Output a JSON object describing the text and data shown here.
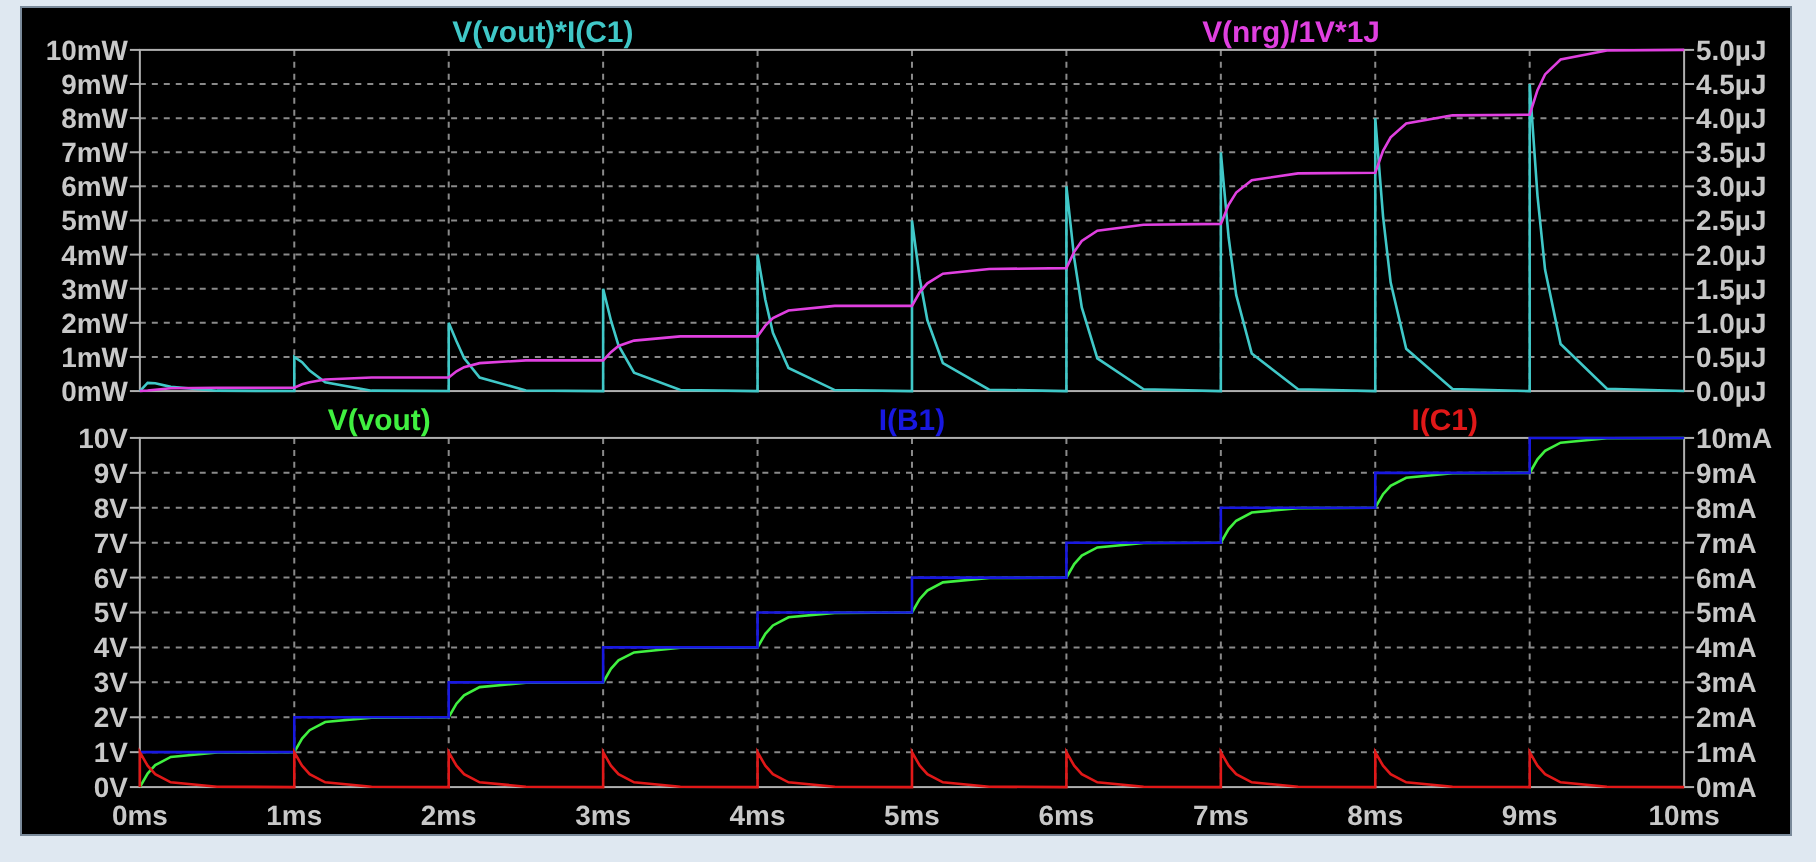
{
  "panes": [
    {
      "chart_data": {
        "type": "line",
        "grid": true,
        "xlim": [
          0,
          10
        ],
        "ylim": [
          0,
          10
        ],
        "y2lim": [
          0,
          5
        ],
        "yticks": [
          {
            "value": 0,
            "label": "0mW"
          },
          {
            "value": 1,
            "label": "1mW"
          },
          {
            "value": 2,
            "label": "2mW"
          },
          {
            "value": 3,
            "label": "3mW"
          },
          {
            "value": 4,
            "label": "4mW"
          },
          {
            "value": 5,
            "label": "5mW"
          },
          {
            "value": 6,
            "label": "6mW"
          },
          {
            "value": 7,
            "label": "7mW"
          },
          {
            "value": 8,
            "label": "8mW"
          },
          {
            "value": 9,
            "label": "9mW"
          },
          {
            "value": 10,
            "label": "10mW"
          }
        ],
        "y2ticks": [
          {
            "value": 0,
            "label": "0.0µJ"
          },
          {
            "value": 0.5,
            "label": "0.5µJ"
          },
          {
            "value": 1,
            "label": "1.0µJ"
          },
          {
            "value": 1.5,
            "label": "1.5µJ"
          },
          {
            "value": 2,
            "label": "2.0µJ"
          },
          {
            "value": 2.5,
            "label": "2.5µJ"
          },
          {
            "value": 3,
            "label": "3.0µJ"
          },
          {
            "value": 3.5,
            "label": "3.5µJ"
          },
          {
            "value": 4,
            "label": "4.0µJ"
          },
          {
            "value": 4.5,
            "label": "4.5µJ"
          },
          {
            "value": 5,
            "label": "5.0µJ"
          }
        ],
        "x": [
          0,
          0,
          0.05,
          0.1,
          0.2,
          0.5,
          1,
          1,
          1.05,
          1.1,
          1.2,
          1.5,
          2,
          2,
          2.05,
          2.1,
          2.2,
          2.5,
          3,
          3,
          3.05,
          3.1,
          3.2,
          3.5,
          4,
          4,
          4.05,
          4.1,
          4.2,
          4.5,
          5,
          5,
          5.05,
          5.1,
          5.2,
          5.5,
          6,
          6,
          6.05,
          6.1,
          6.2,
          6.5,
          7,
          7,
          7.05,
          7.1,
          7.2,
          7.5,
          8,
          8,
          8.05,
          8.1,
          8.2,
          8.5,
          9,
          9,
          9.05,
          9.1,
          9.2,
          9.5,
          10
        ],
        "series": [
          {
            "name": "V(vout)*I(C1)",
            "color": "#40c8c8",
            "values": [
              0,
              0,
              0.24,
              0.23,
              0.12,
              0.01,
              0,
              1,
              0.85,
              0.6,
              0.26,
              0.01,
              0,
              2,
              1.46,
              0.97,
              0.4,
              0.02,
              0,
              3,
              2.07,
              1.34,
              0.54,
              0.03,
              0,
              4,
              2.68,
              1.71,
              0.68,
              0.03,
              0,
              5,
              3.29,
              2.08,
              0.82,
              0.04,
              0,
              6,
              3.9,
              2.45,
              0.96,
              0.05,
              0,
              7,
              4.51,
              2.82,
              1.1,
              0.05,
              0,
              8,
              5.12,
              3.19,
              1.24,
              0.06,
              0,
              9,
              5.73,
              3.56,
              1.38,
              0.07,
              0
            ]
          },
          {
            "name": "V(nrg)/1V*1J",
            "color": "#e040e0",
            "axis": "y2",
            "values": [
              0,
              0,
              0.01,
              0.02,
              0.04,
              0.05,
              0.05,
              0.05,
              0.1,
              0.13,
              0.17,
              0.2,
              0.2,
              0.2,
              0.29,
              0.35,
              0.41,
              0.45,
              0.45,
              0.45,
              0.57,
              0.66,
              0.74,
              0.8,
              0.8,
              0.8,
              0.96,
              1.07,
              1.18,
              1.25,
              1.25,
              1.25,
              1.45,
              1.58,
              1.72,
              1.79,
              1.8,
              1.8,
              2.04,
              2.2,
              2.35,
              2.44,
              2.45,
              2.45,
              2.73,
              2.91,
              3.09,
              3.19,
              3.2,
              3.2,
              3.52,
              3.72,
              3.92,
              4.04,
              4.05,
              4.05,
              4.41,
              4.64,
              4.86,
              4.99,
              5
            ]
          }
        ]
      }
    },
    {
      "chart_data": {
        "type": "line",
        "grid": true,
        "xlim": [
          0,
          10
        ],
        "ylim": [
          0,
          10
        ],
        "y2lim": [
          0,
          10
        ],
        "xticks": [
          {
            "value": 0,
            "label": "0ms"
          },
          {
            "value": 1,
            "label": "1ms"
          },
          {
            "value": 2,
            "label": "2ms"
          },
          {
            "value": 3,
            "label": "3ms"
          },
          {
            "value": 4,
            "label": "4ms"
          },
          {
            "value": 5,
            "label": "5ms"
          },
          {
            "value": 6,
            "label": "6ms"
          },
          {
            "value": 7,
            "label": "7ms"
          },
          {
            "value": 8,
            "label": "8ms"
          },
          {
            "value": 9,
            "label": "9ms"
          },
          {
            "value": 10,
            "label": "10ms"
          }
        ],
        "yticks": [
          {
            "value": 0,
            "label": "0V"
          },
          {
            "value": 1,
            "label": "1V"
          },
          {
            "value": 2,
            "label": "2V"
          },
          {
            "value": 3,
            "label": "3V"
          },
          {
            "value": 4,
            "label": "4V"
          },
          {
            "value": 5,
            "label": "5V"
          },
          {
            "value": 6,
            "label": "6V"
          },
          {
            "value": 7,
            "label": "7V"
          },
          {
            "value": 8,
            "label": "8V"
          },
          {
            "value": 9,
            "label": "9V"
          },
          {
            "value": 10,
            "label": "10V"
          }
        ],
        "y2ticks": [
          {
            "value": 0,
            "label": "0mA"
          },
          {
            "value": 1,
            "label": "1mA"
          },
          {
            "value": 2,
            "label": "2mA"
          },
          {
            "value": 3,
            "label": "3mA"
          },
          {
            "value": 4,
            "label": "4mA"
          },
          {
            "value": 5,
            "label": "5mA"
          },
          {
            "value": 6,
            "label": "6mA"
          },
          {
            "value": 7,
            "label": "7mA"
          },
          {
            "value": 8,
            "label": "8mA"
          },
          {
            "value": 9,
            "label": "9mA"
          },
          {
            "value": 10,
            "label": "10mA"
          }
        ],
        "x": [
          0,
          0,
          0.05,
          0.1,
          0.2,
          0.5,
          1,
          1,
          1.05,
          1.1,
          1.2,
          1.5,
          2,
          2,
          2.05,
          2.1,
          2.2,
          2.5,
          3,
          3,
          3.05,
          3.1,
          3.2,
          3.5,
          4,
          4,
          4.05,
          4.1,
          4.2,
          4.5,
          5,
          5,
          5.05,
          5.1,
          5.2,
          5.5,
          6,
          6,
          6.05,
          6.1,
          6.2,
          6.5,
          7,
          7,
          7.05,
          7.1,
          7.2,
          7.5,
          8,
          8,
          8.05,
          8.1,
          8.2,
          8.5,
          9,
          9,
          9.05,
          9.1,
          9.2,
          9.5,
          10
        ],
        "series": [
          {
            "name": "V(vout)",
            "color": "#40f040",
            "values": [
              0,
              0,
              0.39,
              0.63,
              0.86,
              0.99,
              1,
              1,
              1.39,
              1.63,
              1.86,
              1.99,
              2,
              2,
              2.39,
              2.63,
              2.86,
              2.99,
              3,
              3,
              3.39,
              3.63,
              3.86,
              3.99,
              4,
              4,
              4.39,
              4.63,
              4.86,
              4.99,
              5,
              5,
              5.39,
              5.63,
              5.86,
              5.99,
              6,
              6,
              6.39,
              6.63,
              6.86,
              6.99,
              7,
              7,
              7.39,
              7.63,
              7.86,
              7.99,
              8,
              8,
              8.39,
              8.63,
              8.86,
              8.99,
              9,
              9,
              9.39,
              9.63,
              9.86,
              9.99,
              10
            ]
          },
          {
            "name": "I(B1)",
            "color": "#1818e0",
            "axis": "y2",
            "values": [
              1,
              1,
              1,
              1,
              1,
              1,
              1,
              2,
              2,
              2,
              2,
              2,
              2,
              3,
              3,
              3,
              3,
              3,
              3,
              4,
              4,
              4,
              4,
              4,
              4,
              5,
              5,
              5,
              5,
              5,
              5,
              6,
              6,
              6,
              6,
              6,
              6,
              7,
              7,
              7,
              7,
              7,
              7,
              8,
              8,
              8,
              8,
              8,
              8,
              9,
              9,
              9,
              9,
              9,
              9,
              10,
              10,
              10,
              10,
              10,
              10
            ]
          },
          {
            "name": "I(C1)",
            "color": "#e01818",
            "axis": "y2",
            "values": [
              0,
              1,
              0.61,
              0.37,
              0.14,
              0.01,
              0,
              1,
              0.61,
              0.37,
              0.14,
              0.01,
              0,
              1,
              0.61,
              0.37,
              0.14,
              0.01,
              0,
              1,
              0.61,
              0.37,
              0.14,
              0.01,
              0,
              1,
              0.61,
              0.37,
              0.14,
              0.01,
              0,
              1,
              0.61,
              0.37,
              0.14,
              0.01,
              0,
              1,
              0.61,
              0.37,
              0.14,
              0.01,
              0,
              1,
              0.61,
              0.37,
              0.14,
              0.01,
              0,
              1,
              0.61,
              0.37,
              0.14,
              0.01,
              0,
              1,
              0.61,
              0.37,
              0.14,
              0.01,
              0
            ]
          }
        ]
      }
    }
  ]
}
